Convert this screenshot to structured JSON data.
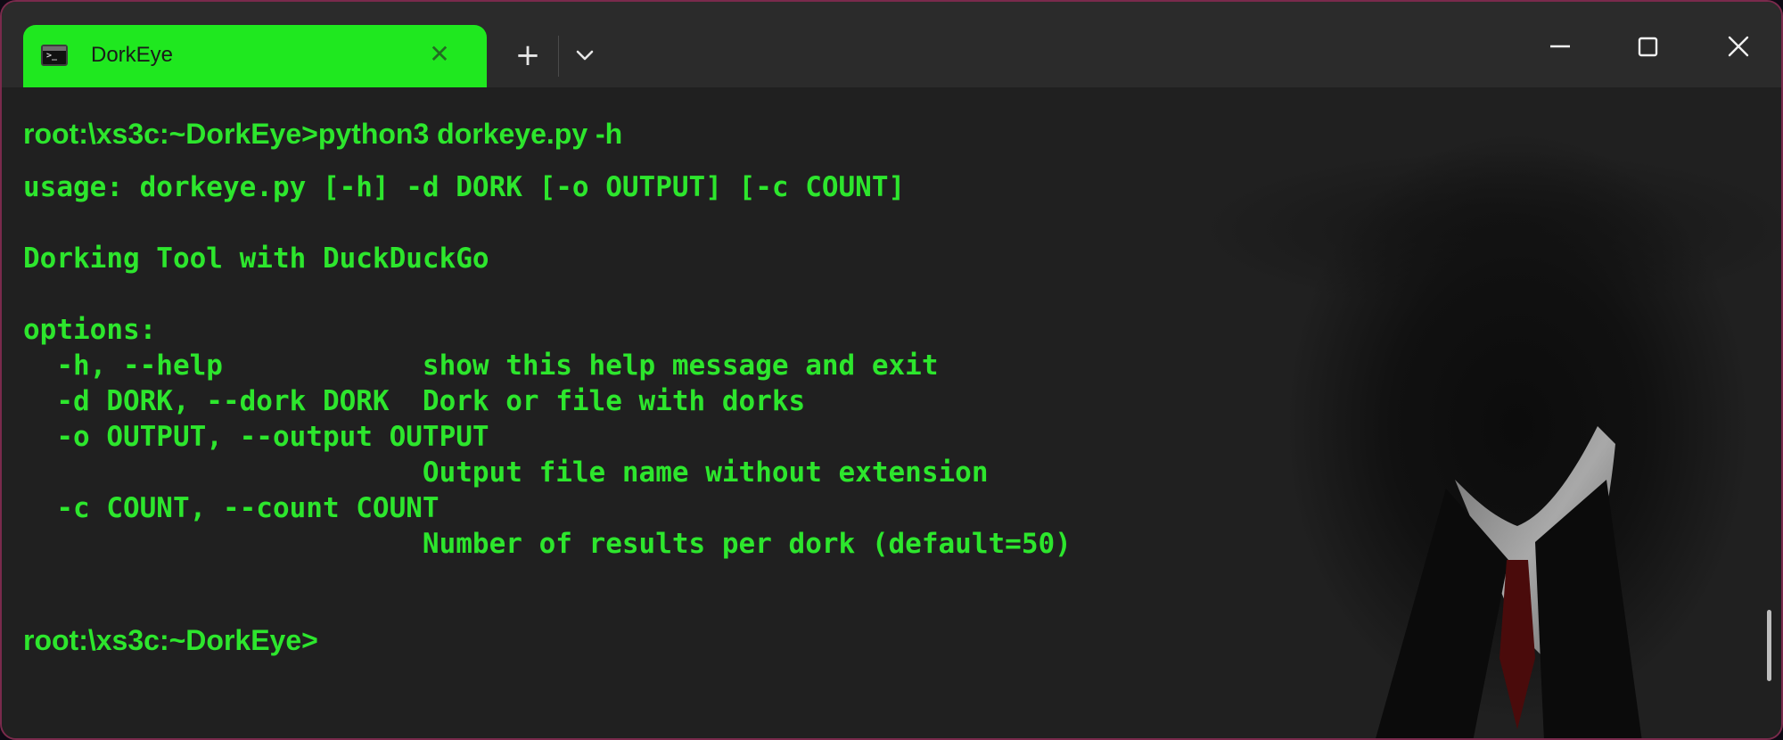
{
  "tab": {
    "icon": "terminal-icon",
    "title": "DorkEye",
    "close_icon": "close-icon"
  },
  "titlebar": {
    "new_tab_icon": "plus-icon",
    "dropdown_icon": "chevron-down-icon",
    "minimize_icon": "minimize-icon",
    "maximize_icon": "maximize-icon",
    "close_icon": "close-icon"
  },
  "colors": {
    "tab_background": "#1fe81f",
    "terminal_text": "#2de62d",
    "terminal_background": "#202020",
    "titlebar_background": "#2b2b2b"
  },
  "terminal": {
    "command_line": "root:\\xs3c:~DorkEye>python3 dorkeye.py -h",
    "usage": "usage: dorkeye.py [-h] -d DORK [-o OUTPUT] [-c COUNT]",
    "description": "Dorking Tool with DuckDuckGo",
    "options_header": "options:",
    "option_help": "  -h, --help            show this help message and exit",
    "option_dork": "  -d DORK, --dork DORK  Dork or file with dorks",
    "option_output": "  -o OUTPUT, --output OUTPUT",
    "option_output_desc": "                        Output file name without extension",
    "option_count": "  -c COUNT, --count COUNT",
    "option_count_desc": "                        Number of results per dork (default=50)",
    "prompt": "root:\\xs3c:~DorkEye>"
  }
}
